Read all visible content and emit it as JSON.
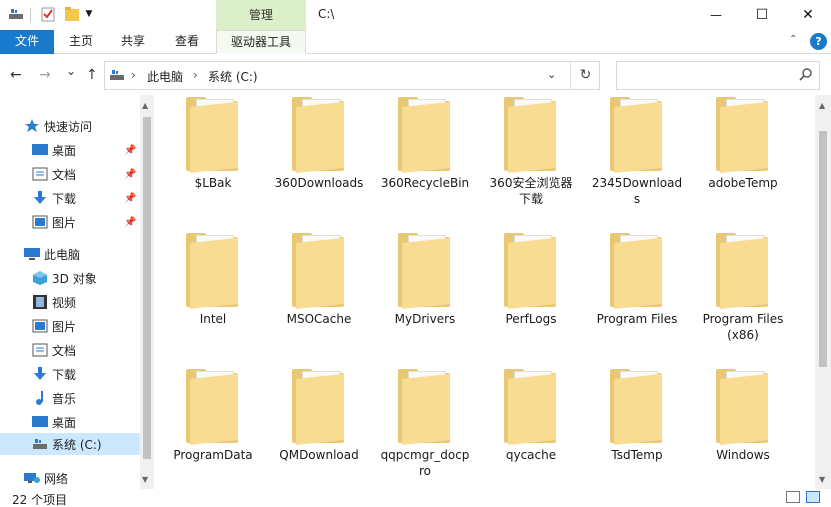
{
  "titlebar": {
    "context_tab": "管理",
    "title": "C:\\",
    "minimize": "—",
    "maximize": "☐",
    "close": "✕"
  },
  "ribbon": {
    "file": "文件",
    "home": "主页",
    "share": "共享",
    "view": "查看",
    "drive_tools": "驱动器工具",
    "help": "?"
  },
  "nav": {
    "back": "←",
    "forward": "→",
    "recent": "⌄",
    "up": "↑",
    "breadcrumb": [
      "此电脑",
      "系统 (C:)"
    ],
    "sep": "›",
    "dropdown": "⌄",
    "refresh": "↻",
    "search_placeholder": "",
    "search_icon": "⌕"
  },
  "sidebar": {
    "quick_access": "快速访问",
    "quick_items": [
      {
        "label": "桌面",
        "icon": "desktop-icon"
      },
      {
        "label": "文档",
        "icon": "document-icon"
      },
      {
        "label": "下载",
        "icon": "download-icon"
      },
      {
        "label": "图片",
        "icon": "picture-icon"
      }
    ],
    "this_pc": "此电脑",
    "pc_items": [
      {
        "label": "3D 对象",
        "icon": "3d-objects-icon"
      },
      {
        "label": "视频",
        "icon": "video-icon"
      },
      {
        "label": "图片",
        "icon": "picture-icon"
      },
      {
        "label": "文档",
        "icon": "document-icon"
      },
      {
        "label": "下载",
        "icon": "download-icon"
      },
      {
        "label": "音乐",
        "icon": "music-icon"
      },
      {
        "label": "桌面",
        "icon": "desktop-icon"
      },
      {
        "label": "系统 (C:)",
        "icon": "drive-icon"
      }
    ],
    "network": "网络"
  },
  "folders": [
    {
      "line1": "$LBak",
      "line2": ""
    },
    {
      "line1": "360Downloads",
      "line2": ""
    },
    {
      "line1": "360RecycleBin",
      "line2": ""
    },
    {
      "line1": "360安全浏览器",
      "line2": "下载"
    },
    {
      "line1": "2345Download",
      "line2": "s"
    },
    {
      "line1": "adobeTemp",
      "line2": ""
    },
    {
      "line1": "Intel",
      "line2": ""
    },
    {
      "line1": "MSOCache",
      "line2": ""
    },
    {
      "line1": "MyDrivers",
      "line2": ""
    },
    {
      "line1": "PerfLogs",
      "line2": ""
    },
    {
      "line1": "Program Files",
      "line2": ""
    },
    {
      "line1": "Program Files",
      "line2": "(x86)"
    },
    {
      "line1": "ProgramData",
      "line2": ""
    },
    {
      "line1": "QMDownload",
      "line2": ""
    },
    {
      "line1": "qqpcmgr_docp",
      "line2": "ro"
    },
    {
      "line1": "qycache",
      "line2": ""
    },
    {
      "line1": "TsdTemp",
      "line2": ""
    },
    {
      "line1": "Windows",
      "line2": ""
    }
  ],
  "status": {
    "item_count": "22 个项目"
  },
  "colors": {
    "accent": "#1979ca",
    "context_tab": "#dbf0c8",
    "folder": "#f7dc91",
    "selection": "#cce8ff"
  }
}
